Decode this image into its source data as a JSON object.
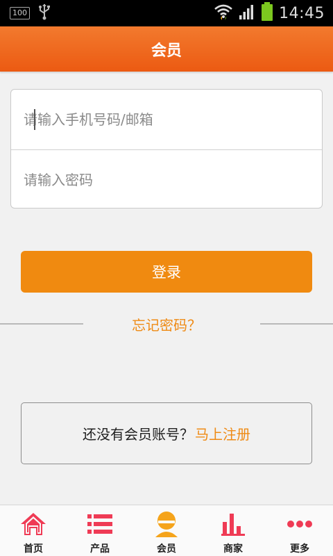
{
  "status_bar": {
    "battery_label": "100",
    "usb_icon": "usb-icon",
    "wifi_icon": "wifi-icon",
    "signal_icon": "signal-icon",
    "battery_icon": "battery-icon",
    "time": "14:45"
  },
  "header": {
    "title": "会员"
  },
  "login_form": {
    "phone_email_placeholder": "请输入手机号码/邮箱",
    "phone_email_value": "",
    "password_placeholder": "请输入密码",
    "password_value": "",
    "login_label": "登录",
    "forgot_label": "忘记密码？"
  },
  "register": {
    "prompt": "还没有会员账号？",
    "link": "马上注册"
  },
  "bottom_nav": {
    "items": [
      {
        "label": "首页",
        "icon": "home-icon"
      },
      {
        "label": "产品",
        "icon": "list-icon"
      },
      {
        "label": "会员",
        "icon": "member-icon",
        "active": true
      },
      {
        "label": "商家",
        "icon": "bar-chart-icon"
      },
      {
        "label": "更多",
        "icon": "more-dots-icon"
      }
    ]
  },
  "colors": {
    "accent": "#f08a10",
    "header_top": "#f27a2e",
    "header_bottom": "#ec5a12",
    "nav_icon": "#ef3b55",
    "member_icon": "#f5a41b",
    "battery_green": "#7cc81f"
  }
}
